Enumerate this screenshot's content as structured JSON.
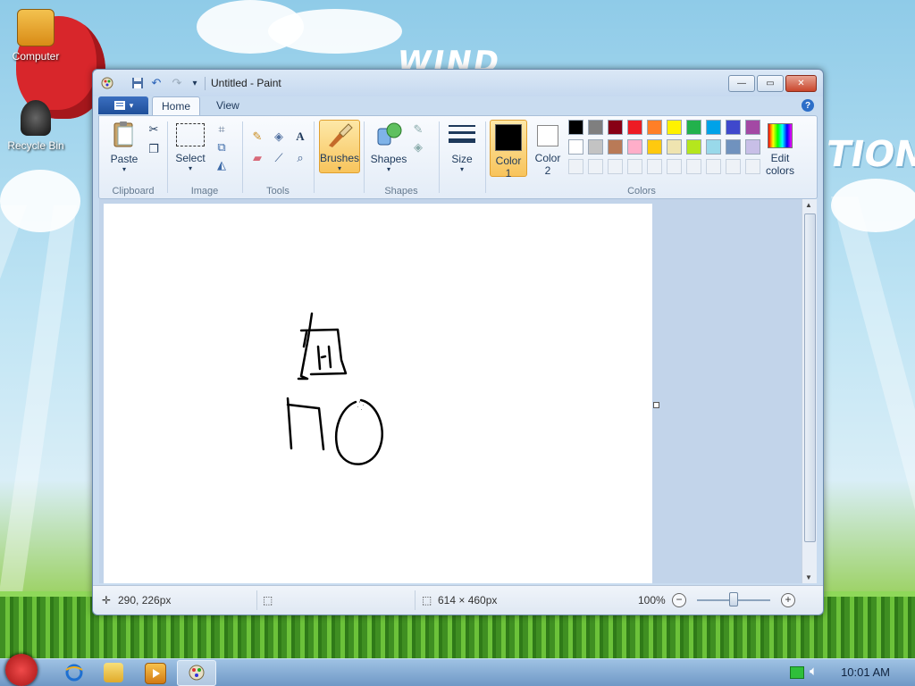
{
  "desktop": {
    "icons": [
      {
        "label": "Computer"
      },
      {
        "label": "Recycle Bin"
      }
    ],
    "wallpaper_text": [
      "WIND",
      "TION"
    ]
  },
  "window": {
    "title": "Untitled - Paint",
    "controls": {
      "minimize": "—",
      "maximize": "▭",
      "close": "✕"
    },
    "quick_access": {
      "save_icon": "save-icon",
      "undo_icon": "undo-icon",
      "redo_icon": "redo-icon",
      "customize": "▾"
    }
  },
  "ribbon": {
    "tabs": [
      {
        "label": "Home"
      },
      {
        "label": "View"
      }
    ],
    "help": "?",
    "clipboard": {
      "paste": "Paste",
      "group": "Clipboard"
    },
    "image": {
      "select": "Select",
      "group": "Image"
    },
    "tools": {
      "group": "Tools",
      "text_tool": "A"
    },
    "brushes": {
      "label": "Brushes"
    },
    "shapes": {
      "label": "Shapes",
      "group": "Shapes"
    },
    "size": {
      "label": "Size"
    },
    "colors": {
      "color1": "Color\n1",
      "color1_line1": "Color",
      "color1_line2": "1",
      "color2_line1": "Color",
      "color2_line2": "2",
      "group": "Colors",
      "edit_line1": "Edit",
      "edit_line2": "colors",
      "color1_value": "#000000",
      "color2_value": "#ffffff",
      "palette_row1": [
        "#000000",
        "#7f7f7f",
        "#880015",
        "#ed1c24",
        "#ff7f27",
        "#fff200",
        "#22b14c",
        "#00a2e8",
        "#3f48cc",
        "#a349a4"
      ],
      "palette_row2": [
        "#ffffff",
        "#c3c3c3",
        "#b97a57",
        "#ffaec9",
        "#ffc90e",
        "#efe4b0",
        "#b5e61d",
        "#99d9ea",
        "#7092be",
        "#c8bfe7"
      ]
    }
  },
  "statusbar": {
    "cursor_pos": "290, 226px",
    "canvas_size": "614 × 460px",
    "zoom": "100%",
    "zoom_out": "−",
    "zoom_in": "+"
  },
  "taskbar": {
    "clock": "10:01 AM"
  }
}
